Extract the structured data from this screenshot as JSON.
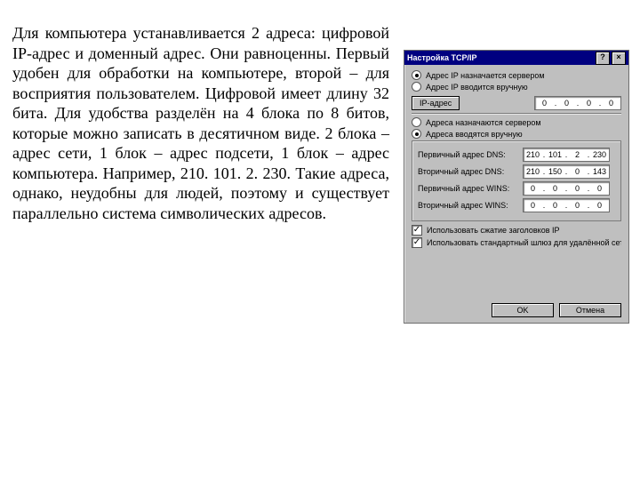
{
  "paragraph": "Для компьютера устанавливается 2 адреса: цифровой IP-адрес и доменный адрес. Они равноценны. Первый удобен для обработки на компьютере, второй – для восприятия пользователем. Цифровой имеет длину 32 бита. Для удобства разделён на 4 блока по 8 битов, которые можно записать в десятичном виде. 2 блока – адрес сети, 1 блок – адрес подсети, 1 блок – адрес компьютера. Например, 210. 101. 2. 230. Такие адреса, однако, неудобны для людей, поэтому и существует параллельно система символических адресов.",
  "dialog": {
    "title": "Настройка TCP/IP",
    "help_btn": "?",
    "close_btn": "×",
    "radios_top": [
      {
        "label": "Адрес IP назначается сервером",
        "selected": true
      },
      {
        "label": "Адрес IP вводится вручную",
        "selected": false
      }
    ],
    "ip_btn": "IP-адрес",
    "ip_disabled": [
      "0",
      "0",
      "0",
      "0"
    ],
    "radios_mid": [
      {
        "label": "Адреса назначаются сервером",
        "selected": false
      },
      {
        "label": "Адреса вводятся вручную",
        "selected": true
      }
    ],
    "ip_rows": [
      {
        "label": "Первичный адрес DNS:",
        "ip": [
          "210",
          "101",
          "2",
          "230"
        ]
      },
      {
        "label": "Вторичный адрес DNS:",
        "ip": [
          "210",
          "150",
          "0",
          "143"
        ]
      },
      {
        "label": "Первичный адрес WINS:",
        "ip": [
          "0",
          "0",
          "0",
          "0"
        ]
      },
      {
        "label": "Вторичный адрес WINS:",
        "ip": [
          "0",
          "0",
          "0",
          "0"
        ]
      }
    ],
    "checks": [
      {
        "label": "Использовать сжатие заголовков IP",
        "selected": true
      },
      {
        "label": "Использовать стандартный шлюз для удалённой сети",
        "selected": true
      }
    ],
    "ok": "OK",
    "cancel": "Отмена"
  }
}
